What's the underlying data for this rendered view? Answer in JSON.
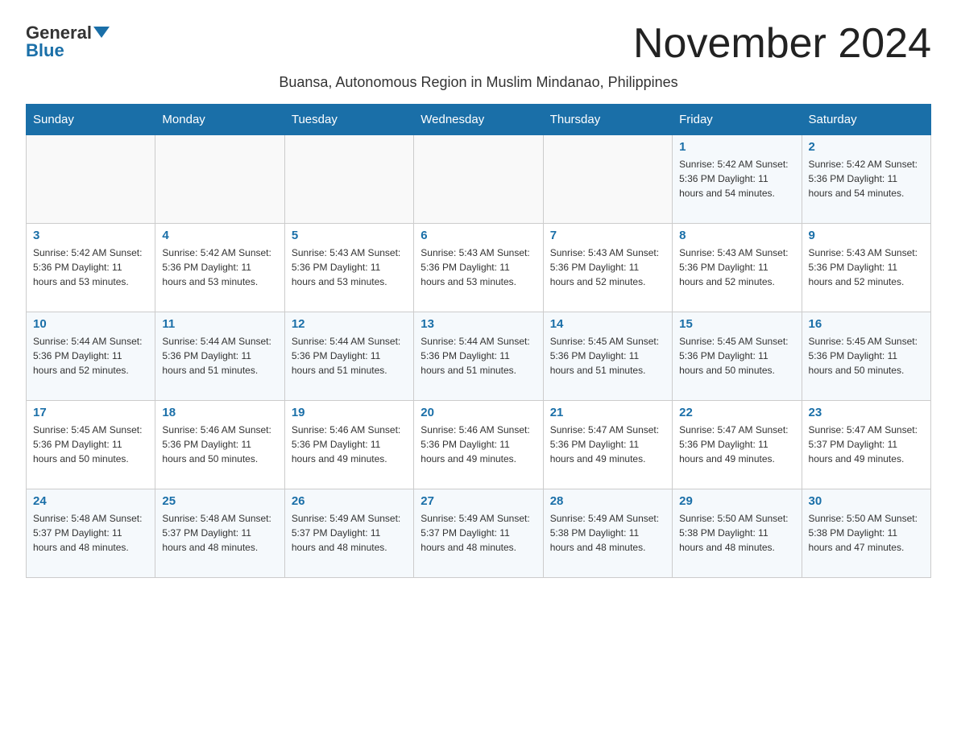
{
  "logo": {
    "general": "General",
    "blue": "Blue"
  },
  "title": "November 2024",
  "subtitle": "Buansa, Autonomous Region in Muslim Mindanao, Philippines",
  "weekdays": [
    "Sunday",
    "Monday",
    "Tuesday",
    "Wednesday",
    "Thursday",
    "Friday",
    "Saturday"
  ],
  "weeks": [
    [
      {
        "day": "",
        "info": ""
      },
      {
        "day": "",
        "info": ""
      },
      {
        "day": "",
        "info": ""
      },
      {
        "day": "",
        "info": ""
      },
      {
        "day": "",
        "info": ""
      },
      {
        "day": "1",
        "info": "Sunrise: 5:42 AM\nSunset: 5:36 PM\nDaylight: 11 hours and 54 minutes."
      },
      {
        "day": "2",
        "info": "Sunrise: 5:42 AM\nSunset: 5:36 PM\nDaylight: 11 hours and 54 minutes."
      }
    ],
    [
      {
        "day": "3",
        "info": "Sunrise: 5:42 AM\nSunset: 5:36 PM\nDaylight: 11 hours and 53 minutes."
      },
      {
        "day": "4",
        "info": "Sunrise: 5:42 AM\nSunset: 5:36 PM\nDaylight: 11 hours and 53 minutes."
      },
      {
        "day": "5",
        "info": "Sunrise: 5:43 AM\nSunset: 5:36 PM\nDaylight: 11 hours and 53 minutes."
      },
      {
        "day": "6",
        "info": "Sunrise: 5:43 AM\nSunset: 5:36 PM\nDaylight: 11 hours and 53 minutes."
      },
      {
        "day": "7",
        "info": "Sunrise: 5:43 AM\nSunset: 5:36 PM\nDaylight: 11 hours and 52 minutes."
      },
      {
        "day": "8",
        "info": "Sunrise: 5:43 AM\nSunset: 5:36 PM\nDaylight: 11 hours and 52 minutes."
      },
      {
        "day": "9",
        "info": "Sunrise: 5:43 AM\nSunset: 5:36 PM\nDaylight: 11 hours and 52 minutes."
      }
    ],
    [
      {
        "day": "10",
        "info": "Sunrise: 5:44 AM\nSunset: 5:36 PM\nDaylight: 11 hours and 52 minutes."
      },
      {
        "day": "11",
        "info": "Sunrise: 5:44 AM\nSunset: 5:36 PM\nDaylight: 11 hours and 51 minutes."
      },
      {
        "day": "12",
        "info": "Sunrise: 5:44 AM\nSunset: 5:36 PM\nDaylight: 11 hours and 51 minutes."
      },
      {
        "day": "13",
        "info": "Sunrise: 5:44 AM\nSunset: 5:36 PM\nDaylight: 11 hours and 51 minutes."
      },
      {
        "day": "14",
        "info": "Sunrise: 5:45 AM\nSunset: 5:36 PM\nDaylight: 11 hours and 51 minutes."
      },
      {
        "day": "15",
        "info": "Sunrise: 5:45 AM\nSunset: 5:36 PM\nDaylight: 11 hours and 50 minutes."
      },
      {
        "day": "16",
        "info": "Sunrise: 5:45 AM\nSunset: 5:36 PM\nDaylight: 11 hours and 50 minutes."
      }
    ],
    [
      {
        "day": "17",
        "info": "Sunrise: 5:45 AM\nSunset: 5:36 PM\nDaylight: 11 hours and 50 minutes."
      },
      {
        "day": "18",
        "info": "Sunrise: 5:46 AM\nSunset: 5:36 PM\nDaylight: 11 hours and 50 minutes."
      },
      {
        "day": "19",
        "info": "Sunrise: 5:46 AM\nSunset: 5:36 PM\nDaylight: 11 hours and 49 minutes."
      },
      {
        "day": "20",
        "info": "Sunrise: 5:46 AM\nSunset: 5:36 PM\nDaylight: 11 hours and 49 minutes."
      },
      {
        "day": "21",
        "info": "Sunrise: 5:47 AM\nSunset: 5:36 PM\nDaylight: 11 hours and 49 minutes."
      },
      {
        "day": "22",
        "info": "Sunrise: 5:47 AM\nSunset: 5:36 PM\nDaylight: 11 hours and 49 minutes."
      },
      {
        "day": "23",
        "info": "Sunrise: 5:47 AM\nSunset: 5:37 PM\nDaylight: 11 hours and 49 minutes."
      }
    ],
    [
      {
        "day": "24",
        "info": "Sunrise: 5:48 AM\nSunset: 5:37 PM\nDaylight: 11 hours and 48 minutes."
      },
      {
        "day": "25",
        "info": "Sunrise: 5:48 AM\nSunset: 5:37 PM\nDaylight: 11 hours and 48 minutes."
      },
      {
        "day": "26",
        "info": "Sunrise: 5:49 AM\nSunset: 5:37 PM\nDaylight: 11 hours and 48 minutes."
      },
      {
        "day": "27",
        "info": "Sunrise: 5:49 AM\nSunset: 5:37 PM\nDaylight: 11 hours and 48 minutes."
      },
      {
        "day": "28",
        "info": "Sunrise: 5:49 AM\nSunset: 5:38 PM\nDaylight: 11 hours and 48 minutes."
      },
      {
        "day": "29",
        "info": "Sunrise: 5:50 AM\nSunset: 5:38 PM\nDaylight: 11 hours and 48 minutes."
      },
      {
        "day": "30",
        "info": "Sunrise: 5:50 AM\nSunset: 5:38 PM\nDaylight: 11 hours and 47 minutes."
      }
    ]
  ]
}
